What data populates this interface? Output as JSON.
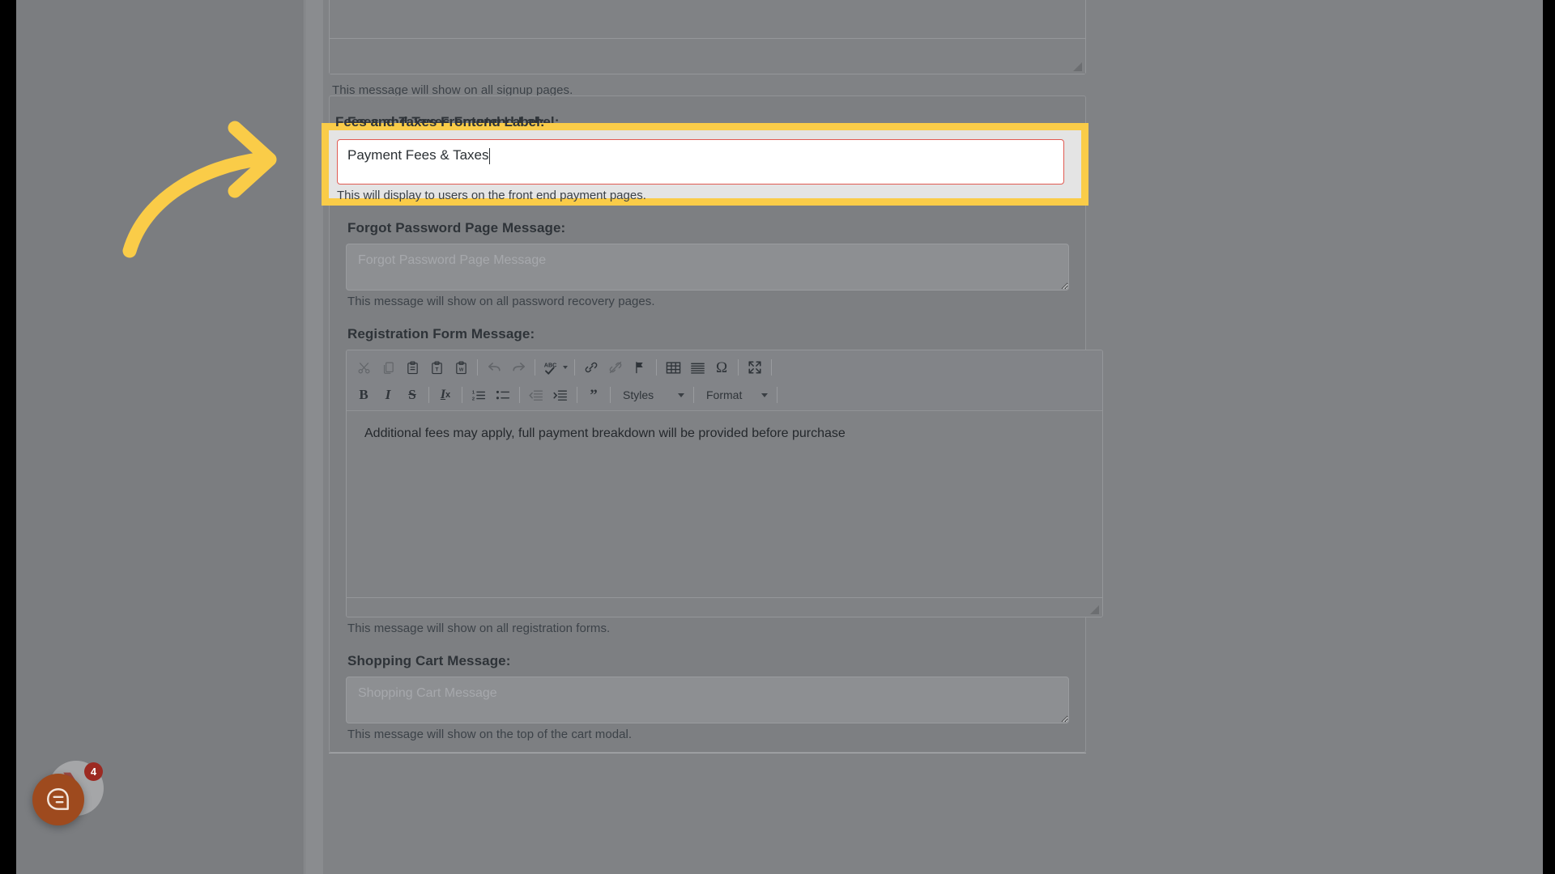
{
  "page": {
    "background_color": "#808285",
    "accent_highlight_color": "#facc48",
    "error_border_color": "#e05a52"
  },
  "fields": [
    {
      "id": "signup_page_message",
      "label": "",
      "help": "This message will show on all signup pages.",
      "type": "ckeditor",
      "value": ""
    },
    {
      "id": "fees_and_taxes_frontend_label",
      "label": "Fees and Taxes Frontend Label:",
      "help": "This will display to users on the front end payment pages.",
      "type": "textarea",
      "value": "Payment Fees & Taxes",
      "placeholder": "Fees and Taxes Frontend Label",
      "highlighted": true,
      "focused": true
    },
    {
      "id": "forgot_password_page_message",
      "label": "Forgot Password Page Message:",
      "help": "This message will show on all password recovery pages.",
      "type": "textarea",
      "value": "",
      "placeholder": "Forgot Password Page Message"
    },
    {
      "id": "registration_form_message",
      "label": "Registration Form Message:",
      "help": "This message will show on all registration forms.",
      "type": "ckeditor",
      "value": "Additional fees may apply, full payment breakdown will be provided before purchase"
    },
    {
      "id": "shopping_cart_message",
      "label": "Shopping Cart Message:",
      "help": "This message will show on the top of the cart modal.",
      "type": "textarea",
      "value": "",
      "placeholder": "Shopping Cart Message"
    }
  ],
  "editor_toolbar": {
    "row1": [
      {
        "name": "cut-icon",
        "title": "Cut",
        "enabled": false
      },
      {
        "name": "copy-icon",
        "title": "Copy",
        "enabled": false
      },
      {
        "name": "paste-icon",
        "title": "Paste",
        "enabled": true
      },
      {
        "name": "paste-as-text-icon",
        "title": "Paste as plain text",
        "enabled": true
      },
      {
        "name": "paste-from-word-icon",
        "title": "Paste from Word",
        "enabled": true
      },
      {
        "name": "undo-icon",
        "title": "Undo",
        "enabled": false
      },
      {
        "name": "redo-icon",
        "title": "Redo",
        "enabled": false
      },
      {
        "name": "spellcheck-icon",
        "title": "Spell Check As You Type",
        "enabled": true
      },
      {
        "name": "link-icon",
        "title": "Link",
        "enabled": true
      },
      {
        "name": "unlink-icon",
        "title": "Unlink",
        "enabled": false
      },
      {
        "name": "anchor-flag-icon",
        "title": "Anchor",
        "enabled": true
      },
      {
        "name": "table-icon",
        "title": "Table",
        "enabled": true
      },
      {
        "name": "horizontal-rule-icon",
        "title": "Horizontal Line",
        "enabled": true
      },
      {
        "name": "special-char-icon",
        "title": "Insert Special Character",
        "enabled": true
      },
      {
        "name": "maximize-icon",
        "title": "Maximize",
        "enabled": true
      }
    ],
    "row2": [
      {
        "name": "bold-icon",
        "title": "Bold",
        "enabled": true
      },
      {
        "name": "italic-icon",
        "title": "Italic",
        "enabled": true
      },
      {
        "name": "strikethrough-icon",
        "title": "Strikethrough",
        "enabled": true
      },
      {
        "name": "remove-format-icon",
        "title": "Remove Format",
        "enabled": true
      },
      {
        "name": "numbered-list-icon",
        "title": "Insert/Remove Numbered List",
        "enabled": true
      },
      {
        "name": "bulleted-list-icon",
        "title": "Insert/Remove Bulleted List",
        "enabled": true
      },
      {
        "name": "outdent-icon",
        "title": "Decrease Indent",
        "enabled": false
      },
      {
        "name": "indent-icon",
        "title": "Increase Indent",
        "enabled": true
      },
      {
        "name": "blockquote-icon",
        "title": "Block Quote",
        "enabled": true
      }
    ],
    "styles_dropdown": {
      "label": "Styles"
    },
    "format_dropdown": {
      "label": "Format"
    }
  },
  "chat_widget": {
    "badge_count": "4",
    "icon": "chat-bubble-icon",
    "color": "#9e4a1e",
    "badge_color": "#9c2a22"
  }
}
